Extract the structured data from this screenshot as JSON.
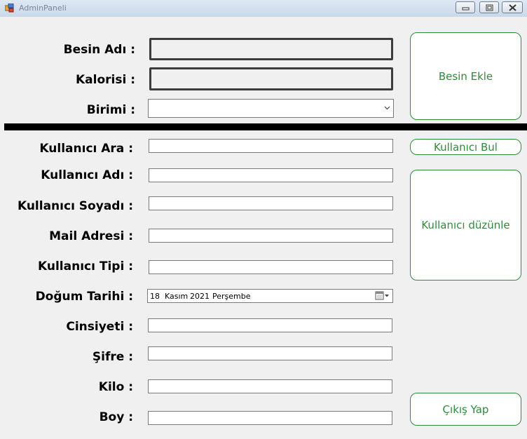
{
  "window": {
    "title": "AdminPaneli"
  },
  "food": {
    "name_label": "Besin Adı :",
    "name_value": "",
    "calories_label": "Kalorisi :",
    "calories_value": "",
    "unit_label": "Birimi :",
    "unit_value": "",
    "add_button": "Besin Ekle"
  },
  "user": {
    "search_label": "Kullanıcı Ara :",
    "search_value": "",
    "find_button": "Kullanıcı Bul",
    "name_label": "Kullanıcı Adı :",
    "name_value": "",
    "surname_label": "Kullanıcı Soyadı :",
    "surname_value": "",
    "mail_label": "Mail Adresi :",
    "mail_value": "",
    "type_label": "Kullanıcı Tipi :",
    "type_value": "",
    "birth_label": "Doğum Tarihi :",
    "birth_day": "18",
    "birth_month": "Kasım",
    "birth_year": "2021",
    "birth_weekday": "Perşembe",
    "gender_label": "Cinsiyeti :",
    "gender_value": "",
    "password_label": "Şifre :",
    "password_value": "",
    "weight_label": "Kilo :",
    "weight_value": "",
    "height_label": "Boy :",
    "height_value": "",
    "edit_button": "Kullanıcı düzünle",
    "logout_button": "Çıkış Yap"
  },
  "icons": {
    "app": "app-icon",
    "minimize": "minimize-icon",
    "maximize": "maximize-icon",
    "close": "close-icon",
    "dropdown": "chevron-down-icon",
    "calendar": "calendar-icon"
  },
  "colors": {
    "button_accent": "#2e8b3e",
    "divider": "#000000"
  }
}
